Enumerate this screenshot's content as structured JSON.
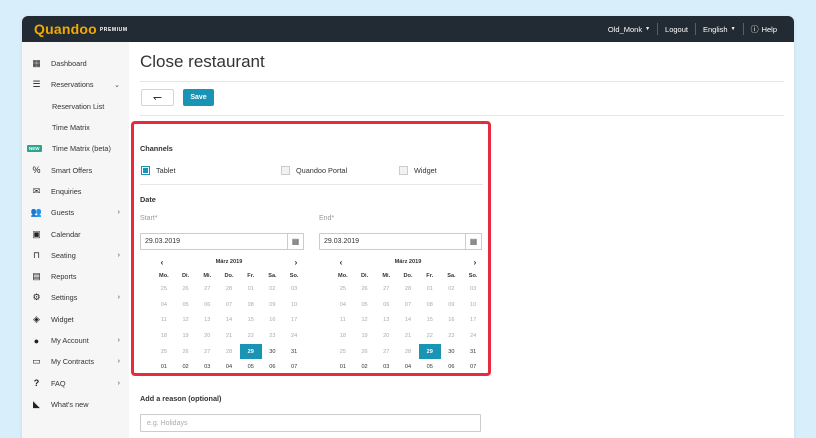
{
  "app": {
    "logo": "Quandoo",
    "logo_badge": "PREMIUM"
  },
  "topnav": {
    "user": "Old_Monk",
    "logout": "Logout",
    "language": "English",
    "help": "Help"
  },
  "sidebar": {
    "items": [
      {
        "label": "Dashboard",
        "icon": "dashboard-icon"
      },
      {
        "label": "Reservations",
        "icon": "list-icon"
      },
      {
        "label": "Reservation List"
      },
      {
        "label": "Time Matrix"
      },
      {
        "label": "Time Matrix (beta)",
        "badge": "NEW"
      },
      {
        "label": "Smart Offers",
        "icon": "percent-icon"
      },
      {
        "label": "Enquiries",
        "icon": "envelope-icon"
      },
      {
        "label": "Guests",
        "icon": "guests-icon"
      },
      {
        "label": "Calendar",
        "icon": "calendar-icon"
      },
      {
        "label": "Seating",
        "icon": "seating-icon"
      },
      {
        "label": "Reports",
        "icon": "reports-icon"
      },
      {
        "label": "Settings",
        "icon": "gear-icon"
      },
      {
        "label": "Widget",
        "icon": "diamond-icon"
      },
      {
        "label": "My Account",
        "icon": "person-icon"
      },
      {
        "label": "My Contracts",
        "icon": "contract-icon"
      },
      {
        "label": "FAQ",
        "icon": "question-icon"
      },
      {
        "label": "What's new",
        "icon": "rss-icon"
      }
    ]
  },
  "page": {
    "title": "Close restaurant",
    "save_label": "Save",
    "back_glyph": "↽"
  },
  "channels": {
    "heading": "Channels",
    "options": [
      {
        "label": "Tablet",
        "checked": true
      },
      {
        "label": "Quandoo Portal",
        "checked": false
      },
      {
        "label": "Widget",
        "checked": false
      }
    ]
  },
  "date": {
    "heading": "Date",
    "start_label": "Start*",
    "end_label": "End*",
    "start_value": "29.03.2019",
    "end_value": "29.03.2019",
    "calendar": {
      "month": "März 2019",
      "prev": "‹",
      "next": "›",
      "weekdays": [
        "Mo.",
        "Di.",
        "Mi.",
        "Do.",
        "Fr.",
        "Sa.",
        "So."
      ],
      "weeks": [
        [
          "25",
          "26",
          "27",
          "28",
          "01",
          "02",
          "03"
        ],
        [
          "04",
          "05",
          "06",
          "07",
          "08",
          "09",
          "10"
        ],
        [
          "11",
          "12",
          "13",
          "14",
          "15",
          "16",
          "17"
        ],
        [
          "18",
          "19",
          "20",
          "21",
          "22",
          "23",
          "24"
        ],
        [
          "25",
          "26",
          "27",
          "28",
          "29",
          "30",
          "31"
        ],
        [
          "01",
          "02",
          "03",
          "04",
          "05",
          "06",
          "07"
        ]
      ],
      "selected": "29"
    }
  },
  "reason": {
    "label": "Add a reason (optional)",
    "placeholder": "e.g. Holidays"
  },
  "colors": {
    "accent": "#1a94b4",
    "highlight": "#e8293e",
    "topbar": "#222b33",
    "logo": "#f2a900"
  }
}
